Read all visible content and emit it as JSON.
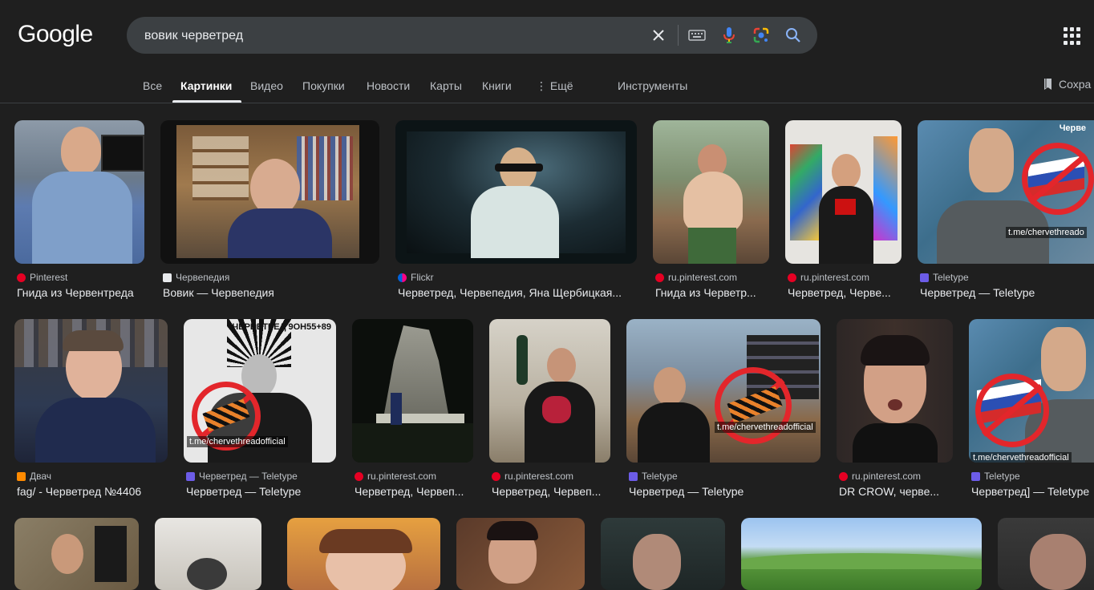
{
  "logo": "Google",
  "search": {
    "query": "вовик черветред"
  },
  "tabs": [
    {
      "label": "Все"
    },
    {
      "label": "Картинки"
    },
    {
      "label": "Видео"
    },
    {
      "label": "Покупки"
    },
    {
      "label": "Новости"
    },
    {
      "label": "Карты"
    },
    {
      "label": "Книги"
    },
    {
      "label": "⋮ Ещё"
    }
  ],
  "tools_label": "Инструменты",
  "saved_label": "Сохра",
  "colors": {
    "background": "#1f1f1f",
    "search_bg": "#3c4043",
    "text": "#e8eaed",
    "muted": "#bdc1c6",
    "ban_red": "#e3262b"
  },
  "results": [
    {
      "source": "Pinterest",
      "title": "Гнида из Червентреда",
      "fav": "pinterest"
    },
    {
      "source": "Червепедия",
      "title": "Вовик — Червепедия",
      "fav": "wiki"
    },
    {
      "source": "Flickr",
      "title": "Черветред, Червепедия, Яна Щербицкая...",
      "fav": "flickr"
    },
    {
      "source": "ru.pinterest.com",
      "title": "Гнида из Черветр...",
      "fav": "pinterest"
    },
    {
      "source": "ru.pinterest.com",
      "title": "Черветред, Черве...",
      "fav": "pinterest"
    },
    {
      "source": "Teletype",
      "title": "Черветред — Teletype",
      "fav": "teletype",
      "wm": "t.me/chervethreado",
      "topText": "Черве"
    },
    {
      "source": "Двач",
      "title": "fag/ - Черветред №4406",
      "fav": "dvach"
    },
    {
      "source": "Черветред — Teletype",
      "title": "Черветред — Teletype",
      "fav": "teletype",
      "wm": "t.me/chervethreadofficial",
      "topText": "ЧЕРВЕТРЕД 9ОН55+89"
    },
    {
      "source": "ru.pinterest.com",
      "title": "Черветред, Червеп...",
      "fav": "pinterest"
    },
    {
      "source": "ru.pinterest.com",
      "title": "Черветред, Червеп...",
      "fav": "pinterest"
    },
    {
      "source": "Teletype",
      "title": "Черветред — Teletype",
      "fav": "teletype",
      "wm": "t.me/chervethreadofficial"
    },
    {
      "source": "ru.pinterest.com",
      "title": "DR CROW, черве...",
      "fav": "pinterest"
    },
    {
      "source": "Teletype",
      "title": "Черветред] — Teletype",
      "fav": "teletype",
      "wm": "t.me/chervethreadofficial"
    }
  ]
}
